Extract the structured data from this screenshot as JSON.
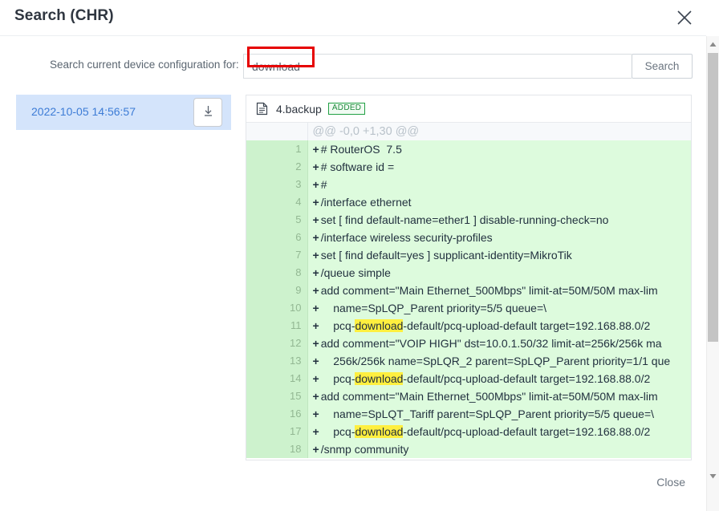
{
  "dialog": {
    "title": "Search (CHR)",
    "close_icon": "close-icon"
  },
  "search": {
    "label": "Search current device configuration for:",
    "value": "download",
    "placeholder": "",
    "button_label": "Search"
  },
  "sidebar": {
    "items": [
      {
        "date": "2022-10-05 14:56:57",
        "download_icon": "download-icon",
        "selected": true
      }
    ]
  },
  "diff": {
    "file_name": "4.backup",
    "file_icon": "file-icon",
    "status_badge": "ADDED",
    "hunk_header": "@@ -0,0 +1,30 @@",
    "lines": [
      {
        "num": "1",
        "marker": "+",
        "text": "# RouterOS  7.5"
      },
      {
        "num": "2",
        "marker": "+",
        "text": "# software id = "
      },
      {
        "num": "3",
        "marker": "+",
        "text": "#"
      },
      {
        "num": "4",
        "marker": "+",
        "text": "/interface ethernet"
      },
      {
        "num": "5",
        "marker": "+",
        "text": "set [ find default-name=ether1 ] disable-running-check=no"
      },
      {
        "num": "6",
        "marker": "+",
        "text": "/interface wireless security-profiles"
      },
      {
        "num": "7",
        "marker": "+",
        "text": "set [ find default=yes ] supplicant-identity=MikroTik"
      },
      {
        "num": "8",
        "marker": "+",
        "text": "/queue simple"
      },
      {
        "num": "9",
        "marker": "+",
        "text": "add comment=\"Main Ethernet_500Mbps\" limit-at=50M/50M max-lim"
      },
      {
        "num": "10",
        "marker": "+",
        "text": "    name=SpLQP_Parent priority=5/5 queue=\\"
      },
      {
        "num": "11",
        "marker": "+",
        "text": "    pcq-download-default/pcq-upload-default target=192.168.88.0/2"
      },
      {
        "num": "12",
        "marker": "+",
        "text": "add comment=\"VOIP HIGH\" dst=10.0.1.50/32 limit-at=256k/256k ma"
      },
      {
        "num": "13",
        "marker": "+",
        "text": "    256k/256k name=SpLQR_2 parent=SpLQP_Parent priority=1/1 que"
      },
      {
        "num": "14",
        "marker": "+",
        "text": "    pcq-download-default/pcq-upload-default target=192.168.88.0/2"
      },
      {
        "num": "15",
        "marker": "+",
        "text": "add comment=\"Main Ethernet_500Mbps\" limit-at=50M/50M max-lim"
      },
      {
        "num": "16",
        "marker": "+",
        "text": "    name=SpLQT_Tariff parent=SpLQP_Parent priority=5/5 queue=\\"
      },
      {
        "num": "17",
        "marker": "+",
        "text": "    pcq-download-default/pcq-upload-default target=192.168.88.0/2"
      },
      {
        "num": "18",
        "marker": "+",
        "text": "/snmp community"
      }
    ],
    "highlight_term": "download"
  },
  "footer": {
    "close_label": "Close"
  },
  "colors": {
    "accent_blue": "#3d7cd6",
    "selected_row": "#d4e4fb",
    "diff_add_bg": "#ddfbdd",
    "diff_add_gutter": "#cdf2cd",
    "added_badge": "#22a045",
    "highlight": "#ffef3f",
    "annotation_red": "#e60000"
  }
}
